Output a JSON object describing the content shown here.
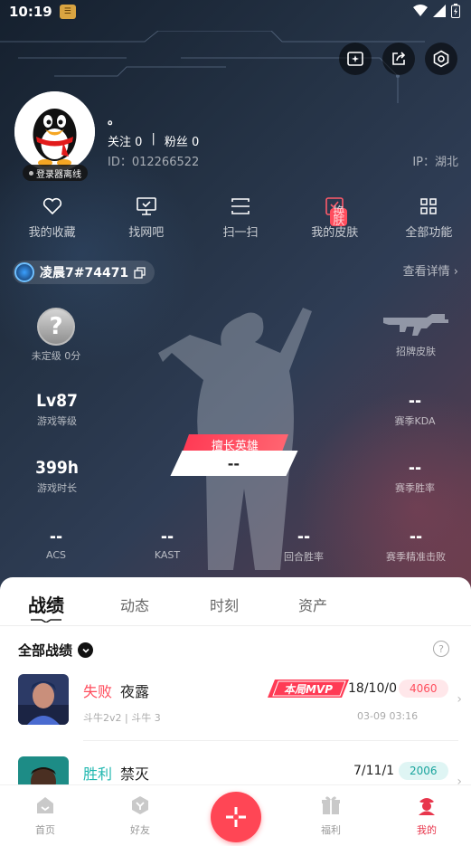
{
  "status_bar": {
    "time": "10:19"
  },
  "profile": {
    "nickname": "。",
    "follow_label": "关注",
    "follow_count": "0",
    "separator": "|",
    "fans_label": "粉丝",
    "fans_count": "0",
    "id_text": "ID：012266522",
    "ip_text": "IP：湖北",
    "recorder_status": "登录器离线"
  },
  "quick_actions": [
    {
      "label": "我的收藏",
      "icon": "heart-icon"
    },
    {
      "label": "找网吧",
      "icon": "monitor-icon"
    },
    {
      "label": "扫一扫",
      "icon": "scan-icon"
    },
    {
      "label": "我的皮肤",
      "icon": "skin-icon",
      "tag": "换肤"
    },
    {
      "label": "全部功能",
      "icon": "grid-icon"
    }
  ],
  "account": {
    "name": "凌晨7#74471",
    "view_detail": "查看详情",
    "view_detail_arrow": "›"
  },
  "stats": {
    "rank": {
      "symbol": "?",
      "label": "未定级 0分"
    },
    "level": {
      "value": "Lv87",
      "label": "游戏等级"
    },
    "hours": {
      "value": "399h",
      "label": "游戏时长"
    },
    "skin": {
      "label": "招牌皮肤"
    },
    "kda": {
      "value": "--",
      "label": "赛季KDA"
    },
    "winrate": {
      "value": "--",
      "label": "赛季胜率"
    },
    "hero_tag": "擅长英雄",
    "hero_value": "--",
    "acs": {
      "value": "--",
      "label": "ACS"
    },
    "kast": {
      "value": "--",
      "label": "KAST"
    },
    "round_win": {
      "value": "--",
      "label": "回合胜率"
    },
    "headshot": {
      "value": "--",
      "label": "赛季精准击败"
    }
  },
  "tabs": [
    "战绩",
    "动态",
    "时刻",
    "资产"
  ],
  "filter": {
    "label": "全部战绩",
    "help": "?"
  },
  "matches": [
    {
      "result": "失败",
      "agent": "夜露",
      "mode": "斗牛2v2 | 斗牛 3",
      "kda": "18/10/0",
      "score": "4060",
      "date": "03-09 03:16",
      "mvp": "本局MVP",
      "result_color": "#ff4d5d",
      "score_bg": "#ffe7ea",
      "score_color": "#ff4d5d"
    },
    {
      "result": "胜利",
      "agent": "禁灭",
      "kda": "7/11/1",
      "score": "2006",
      "result_color": "#22b8b0",
      "score_bg": "#dff5f4",
      "score_color": "#1aa49d"
    }
  ],
  "bottom_nav": [
    {
      "label": "首页",
      "icon": "home-icon"
    },
    {
      "label": "好友",
      "icon": "friends-icon"
    },
    {
      "label": "福利",
      "icon": "gift-icon"
    },
    {
      "label": "我的",
      "icon": "profile-icon"
    }
  ],
  "colors": {
    "accent": "#ff4655",
    "win": "#22b8b0",
    "loss": "#ff4d5d"
  }
}
